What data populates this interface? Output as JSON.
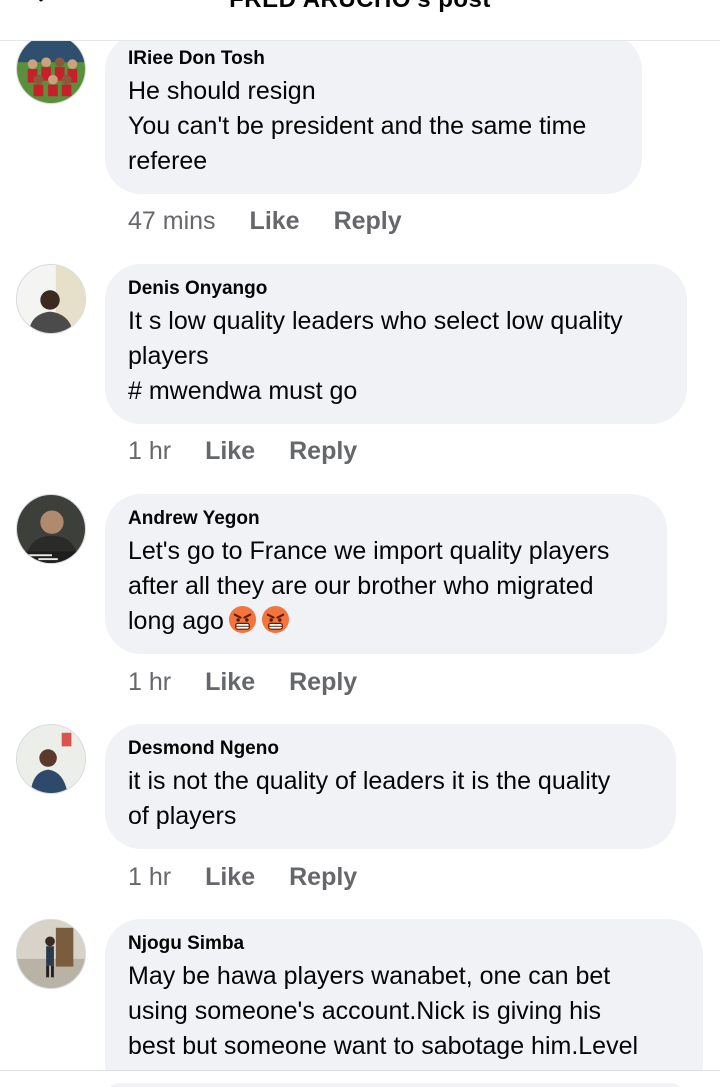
{
  "header": {
    "title": "FRED ARUCHO's post"
  },
  "comments": [
    {
      "author": "IRiee Don Tosh",
      "text": "He should resign\nYou can't be president and the same time\nreferee",
      "time": "47 mins",
      "like": "Like",
      "reply": "Reply"
    },
    {
      "author": "Denis Onyango",
      "text": "It s low quality leaders who select low quality\nplayers\n# mwendwa must go",
      "time": "1 hr",
      "like": "Like",
      "reply": "Reply"
    },
    {
      "author": "Andrew Yegon",
      "text": "Let's go to France we import quality players\nafter all they are our brother who migrated\nlong ago",
      "emojis": [
        "angry-face",
        "angry-face"
      ],
      "time": "1 hr",
      "like": "Like",
      "reply": "Reply"
    },
    {
      "author": "Desmond Ngeno",
      "text": "it is not the quality of leaders it is the quality\nof players",
      "time": "1 hr",
      "like": "Like",
      "reply": "Reply"
    },
    {
      "author": "Njogu Simba",
      "text": "May be hawa players wanabet, one can bet\nusing someone's account.Nick is giving his\nbest but someone want to sabotage him.Level",
      "time": "",
      "like": "",
      "reply": ""
    }
  ],
  "colors": {
    "bubble": "#f0f2f5",
    "meta": "#65676b",
    "text": "#050505"
  }
}
